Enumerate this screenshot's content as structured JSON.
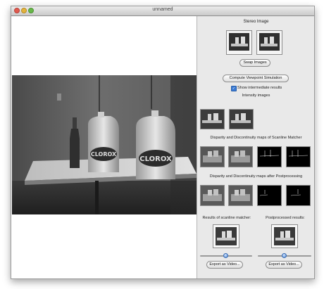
{
  "window": {
    "title": "unnamed"
  },
  "panel": {
    "stereo_title": "Stereo Image",
    "swap_button": "Swap Images",
    "compute_button": "Compute Viewpoint Simulation",
    "show_intermediate": {
      "label": "Show intermediate results",
      "checked": true
    },
    "intensity_title": "Intensity images",
    "disparity_scanline_title": "Disparity and Discontinuity maps of Scanline Matcher",
    "disparity_post_title": "Disparity and Discontinuity maps after Postprocessing",
    "results_scanline_title": "Results of scanline matcher:",
    "results_post_title": "Postprocessed results:",
    "export_left_button": "Export as Video...",
    "export_right_button": "Export as Video...",
    "slider_left_value": 0.5,
    "slider_right_value": 0.5
  },
  "colors": {
    "accent": "#3c7bd4",
    "panel_bg": "#e9e9e9",
    "thumb_bg": "#2b2b2b"
  }
}
